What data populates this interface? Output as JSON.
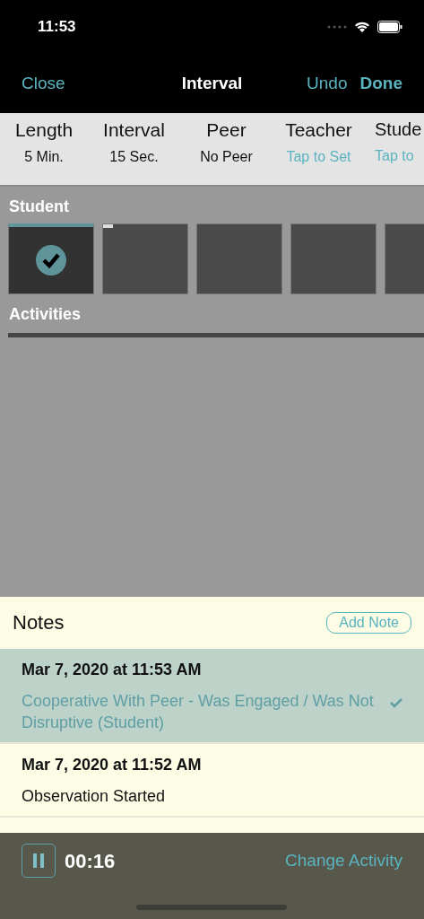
{
  "status_bar": {
    "time": "11:53"
  },
  "nav": {
    "left": "Close",
    "title": "Interval",
    "undo": "Undo",
    "done": "Done"
  },
  "settings": [
    {
      "label": "Length",
      "value": "5 Min.",
      "kind": "value"
    },
    {
      "label": "Interval",
      "value": "15 Sec.",
      "kind": "value"
    },
    {
      "label": "Peer",
      "value": "No Peer",
      "kind": "value"
    },
    {
      "label": "Teacher",
      "value": "Tap to Set",
      "kind": "link"
    },
    {
      "label": "Stude",
      "value": "Tap to",
      "kind": "link"
    }
  ],
  "student": {
    "title": "Student",
    "intervals": [
      {
        "selected": true,
        "current": false
      },
      {
        "selected": false,
        "current": true
      },
      {
        "selected": false,
        "current": false
      },
      {
        "selected": false,
        "current": false
      },
      {
        "selected": false,
        "current": false
      }
    ]
  },
  "activities": {
    "title": "Activities"
  },
  "notes": {
    "title": "Notes",
    "add_button": "Add Note",
    "items": [
      {
        "date": "Mar 7, 2020 at 11:53 AM",
        "text": "Cooperative With Peer - Was Engaged / Was Not Disruptive (Student)",
        "selected": true
      },
      {
        "date": "Mar 7, 2020 at 11:52 AM",
        "text": "Observation Started",
        "selected": false
      }
    ]
  },
  "footer": {
    "timer": "00:16",
    "action": "Change Activity"
  }
}
